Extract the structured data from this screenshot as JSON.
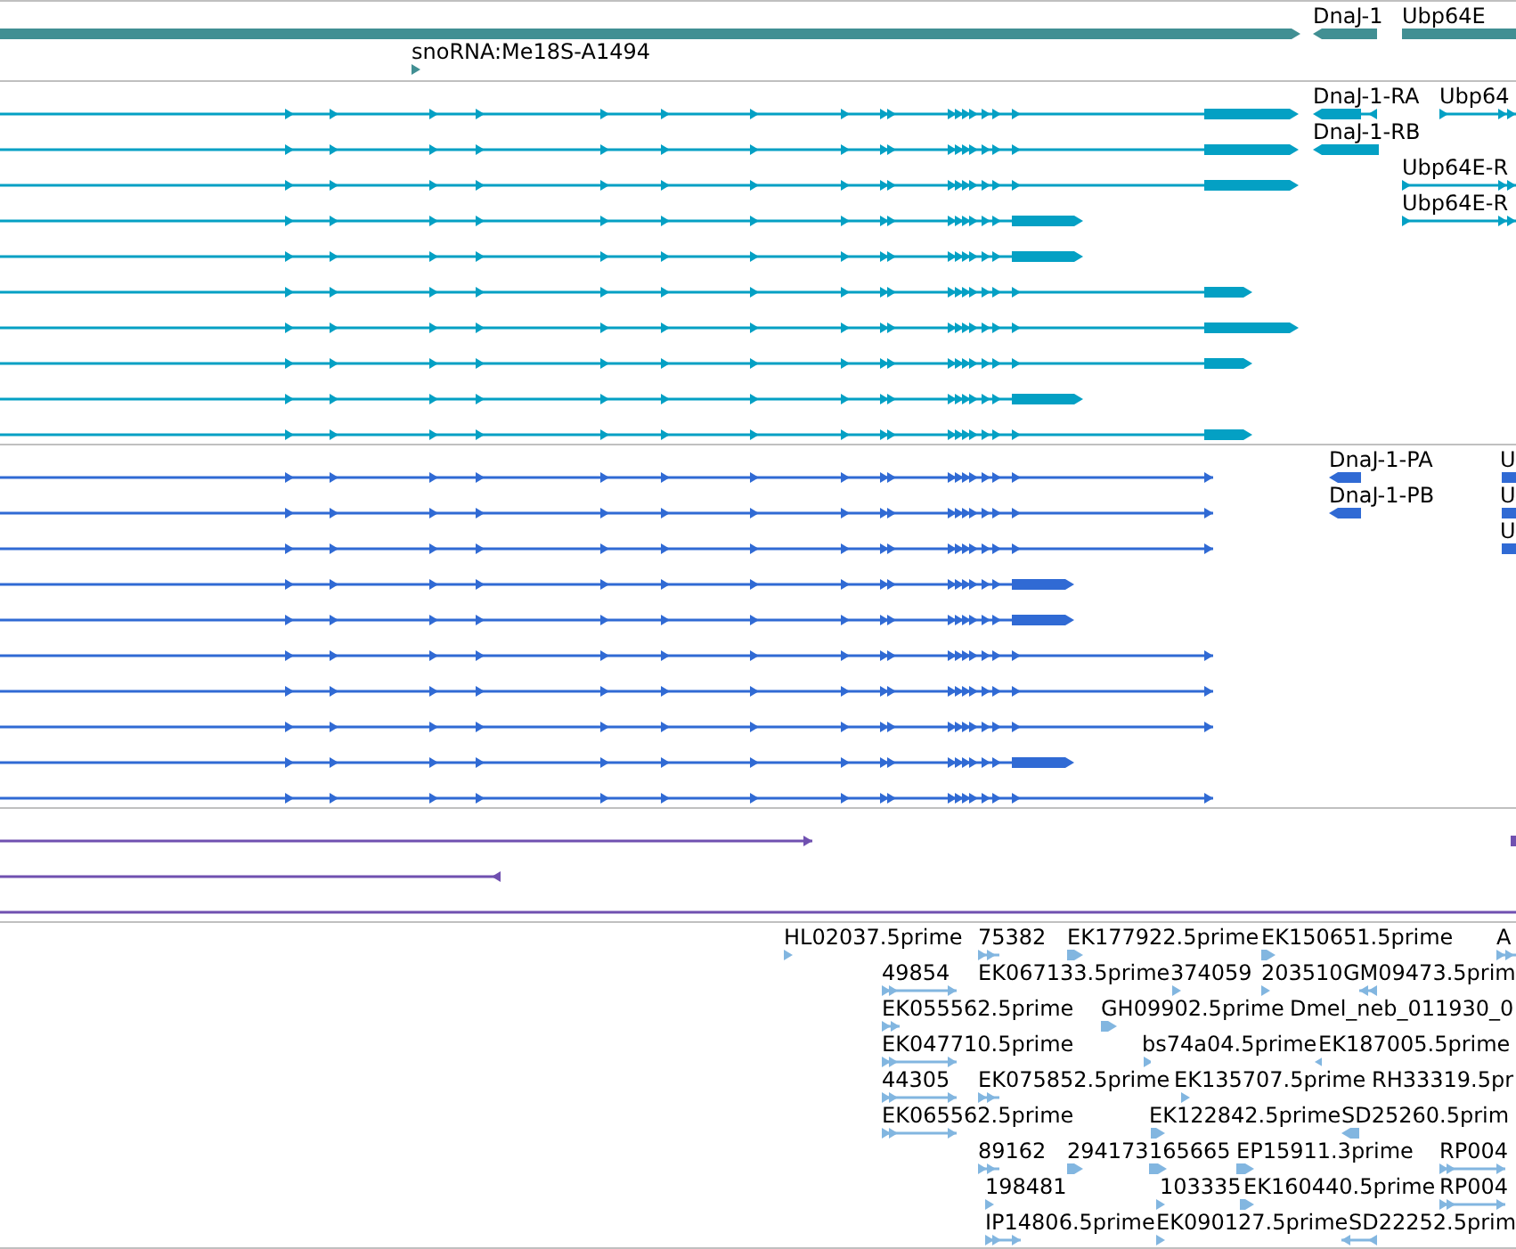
{
  "tracks": [
    {
      "color": "#418f93",
      "rows": [
        {
          "kind": "span_bar"
        }
      ],
      "features": [
        {
          "label": "DnaJ-1",
          "kind": "bar_rev"
        },
        {
          "label": "Ubp64E",
          "kind": "bar"
        },
        {
          "label": "snoRNA:Me18S-A1494",
          "kind": "marker"
        }
      ]
    },
    {
      "color": "#04a0c4",
      "rows": [
        {
          "kind": "long"
        },
        {
          "kind": "long"
        },
        {
          "kind": "long"
        },
        {
          "kind": "short"
        },
        {
          "kind": "short"
        },
        {
          "kind": "medium"
        },
        {
          "kind": "long"
        },
        {
          "kind": "medium"
        },
        {
          "kind": "short"
        },
        {
          "kind": "medium"
        }
      ],
      "features": [
        {
          "label": "DnaJ-1-RA",
          "kind": "model_rev"
        },
        {
          "label": "Ubp64",
          "kind": "model"
        },
        {
          "label": "DnaJ-1-RB",
          "kind": "bar_rev"
        },
        {
          "label": "Ubp64E-R",
          "kind": "model"
        },
        {
          "label": "Ubp64E-R",
          "kind": "model"
        }
      ]
    },
    {
      "color": "#306ad4",
      "rows": [
        {
          "kind": "line"
        },
        {
          "kind": "line"
        },
        {
          "kind": "line"
        },
        {
          "kind": "block"
        },
        {
          "kind": "block"
        },
        {
          "kind": "line"
        },
        {
          "kind": "line"
        },
        {
          "kind": "line"
        },
        {
          "kind": "block"
        },
        {
          "kind": "line"
        }
      ],
      "features": [
        {
          "label": "DnaJ-1-PA",
          "kind": "bar_rev"
        },
        {
          "label": "U",
          "kind": "bar"
        },
        {
          "label": "DnaJ-1-PB",
          "kind": "bar_rev"
        },
        {
          "label": "U",
          "kind": "bar"
        },
        {
          "label": "U",
          "kind": "bar"
        }
      ]
    },
    {
      "color": "#7050b0",
      "rows": [
        {
          "kind": "forward"
        },
        {
          "kind": "reverse"
        },
        {
          "kind": "span"
        }
      ],
      "features": [
        {
          "kind": "bar"
        }
      ]
    },
    {
      "color": "#82b6e0",
      "features": [
        {
          "label": "HL02037.5prime",
          "kind": "marker"
        },
        {
          "label": "75382",
          "kind": "pair"
        },
        {
          "label": "EK177922.5prime",
          "kind": "marker"
        },
        {
          "label": "EK150651.5prime",
          "kind": "marker"
        },
        {
          "label": "A",
          "kind": "pair"
        },
        {
          "label": "49854",
          "kind": "spliced"
        },
        {
          "label": "EK067133.5prime"
        },
        {
          "label": "374059",
          "kind": "marker"
        },
        {
          "label": "203510",
          "kind": "marker"
        },
        {
          "label": "GM09473.5prim",
          "kind": "spliced_rev"
        },
        {
          "label": "EK055562.5prime",
          "kind": "pair"
        },
        {
          "label": "GH09902.5prime",
          "kind": "marker"
        },
        {
          "label": "Dmel_neb_011930_0"
        },
        {
          "label": "EK047710.5prime",
          "kind": "spliced"
        },
        {
          "label": "bs74a04.5prime",
          "kind": "marker"
        },
        {
          "label": "EK187005.5prime",
          "kind": "marker_rev"
        },
        {
          "label": "44305",
          "kind": "spliced"
        },
        {
          "label": "EK075852.5prime",
          "kind": "pair"
        },
        {
          "label": "EK135707.5prime",
          "kind": "marker"
        },
        {
          "label": "RH33319.5pr"
        },
        {
          "label": "EK065562.5prime",
          "kind": "spliced"
        },
        {
          "label": "EK122842.5prime",
          "kind": "marker"
        },
        {
          "label": "SD25260.5prim",
          "kind": "marker_rev"
        },
        {
          "label": "89162",
          "kind": "pair"
        },
        {
          "label": "294173",
          "kind": "marker"
        },
        {
          "label": "165665",
          "kind": "marker"
        },
        {
          "label": "EP15911.3prime",
          "kind": "marker"
        },
        {
          "label": "RP004",
          "kind": "spliced"
        },
        {
          "label": "198481",
          "kind": "marker"
        },
        {
          "label": "103335",
          "kind": "marker"
        },
        {
          "label": "EK160440.5prime",
          "kind": "marker"
        },
        {
          "label": "RP004",
          "kind": "spliced"
        },
        {
          "label": "IP14806.5prime",
          "kind": "spliced"
        },
        {
          "label": "EK090127.5prime",
          "kind": "marker"
        },
        {
          "label": "SD22252.5prim",
          "kind": "spliced_rev"
        }
      ]
    }
  ]
}
